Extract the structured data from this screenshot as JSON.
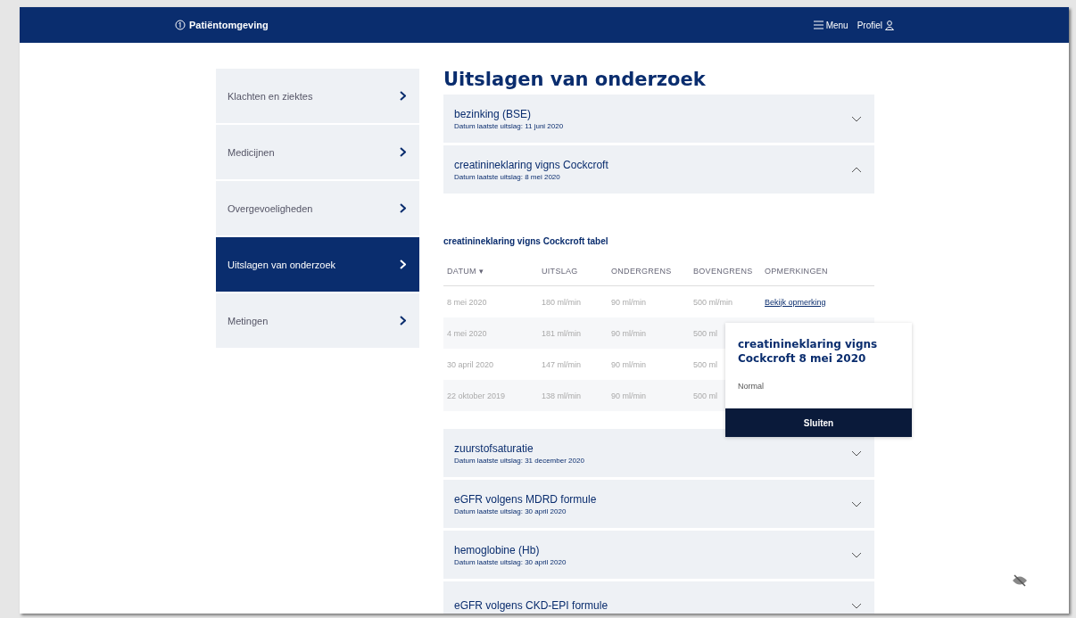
{
  "header": {
    "logo": "Patiëntomgeving",
    "menu": "Menu",
    "profile": "Profiel"
  },
  "sidebar": {
    "items": [
      {
        "label": "Klachten en ziektes",
        "selected": false
      },
      {
        "label": "Medicijnen",
        "selected": false
      },
      {
        "label": "Overgevoeligheden",
        "selected": false
      },
      {
        "label": "Uitslagen van onderzoek",
        "selected": true
      },
      {
        "label": "Metingen",
        "selected": false
      }
    ]
  },
  "title": "Uitslagen van onderzoek",
  "results_top": [
    {
      "name": "bezinking (BSE)",
      "date": "Datum laatste uitslag: 11 juni 2020",
      "expanded": false
    },
    {
      "name": "creatinineklaring vigns Cockcroft",
      "date": "Datum laatste uitslag: 8 mei 2020",
      "expanded": true
    }
  ],
  "table": {
    "title": "creatinineklaring vigns Cockcroft tabel",
    "columns": [
      "DATUM ▾",
      "UITSLAG",
      "ONDERGRENS",
      "BOVENGRENS",
      "OPMERKINGEN"
    ],
    "rows": [
      [
        "8 mei 2020",
        "180 ml/min",
        "90 ml/min",
        "500 ml/min",
        "Bekijk opmerking"
      ],
      [
        "4 mei 2020",
        "181 ml/min",
        "90 ml/min",
        "500 ml"
      ],
      [
        "30 april 2020",
        "147 ml/min",
        "90 ml/min",
        "500 ml"
      ],
      [
        "22 oktober 2019",
        "138 ml/min",
        "90 ml/min",
        "500 ml"
      ]
    ]
  },
  "popup": {
    "title": "creatinineklaring vigns Cockcroft 8 mei 2020",
    "body": "Normal",
    "button": "Sluiten"
  },
  "results_bottom": [
    {
      "name": "zuurstofsaturatie",
      "date": "Datum laatste uitslag: 31 december 2020",
      "expanded": false
    },
    {
      "name": "eGFR volgens MDRD formule",
      "date": "Datum laatste uitslag: 30 april 2020",
      "expanded": false
    },
    {
      "name": "hemoglobine (Hb)",
      "date": "Datum laatste uitslag: 30 april 2020",
      "expanded": false
    },
    {
      "name": "eGFR volgens CKD-EPI formule",
      "expanded": false
    }
  ]
}
